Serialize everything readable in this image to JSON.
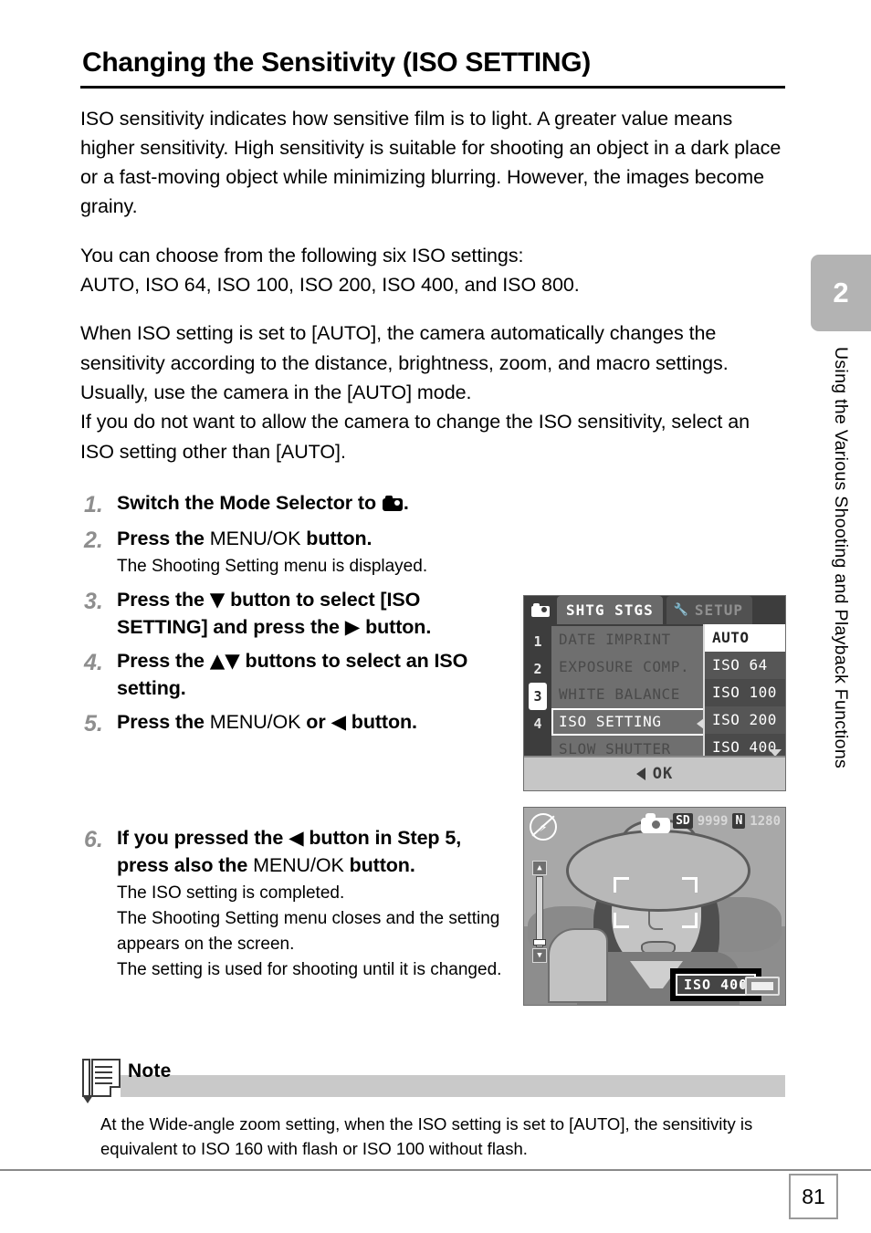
{
  "header": {
    "title": "Changing the Sensitivity (ISO SETTING)"
  },
  "sidebar": {
    "chapter_number": "2",
    "chapter_title": "Using the Various Shooting and Playback Functions"
  },
  "paragraphs": {
    "p1": "ISO sensitivity indicates how sensitive film is to light. A greater value means higher sensitivity. High sensitivity is suitable for shooting an object in a dark place or a fast-moving object while minimizing blurring. However, the images become grainy.",
    "p2_line1": "You can choose from the following six ISO settings:",
    "p2_line2": "AUTO, ISO 64, ISO 100, ISO 200, ISO 400, and ISO 800.",
    "p3_line1": "When ISO setting is set to [AUTO], the camera automatically changes the sensitivity according to the distance, brightness, zoom, and macro settings. Usually, use the camera in the [AUTO] mode.",
    "p3_line2": "If you do not want to allow the camera to change the ISO sensitivity, select an ISO setting other than [AUTO]."
  },
  "steps": [
    {
      "number": "1.",
      "text_before": "Switch the Mode Selector to ",
      "text_after": ".",
      "icon": "camera-mode-icon"
    },
    {
      "number": "2.",
      "text_before": "Press the ",
      "button_label": "MENU/OK",
      "text_after": " button.",
      "sub": [
        "The Shooting Setting menu is displayed."
      ]
    },
    {
      "number": "3.",
      "text_before": "Press the ",
      "glyph1": "▼",
      "text_mid": " button to select [ISO SETTING] and press the ",
      "glyph2": "▶",
      "text_after": " button."
    },
    {
      "number": "4.",
      "text_before": "Press the ",
      "glyph1": "▲▼",
      "text_after": " buttons to select an ISO setting."
    },
    {
      "number": "5.",
      "text_before": "Press the ",
      "button_label": "MENU/OK",
      "text_mid": " or ",
      "glyph1": "◀",
      "text_after": " button."
    },
    {
      "number": "6.",
      "text_before": "If you pressed the ",
      "glyph1": "◀",
      "text_mid": " button in Step 5, press also the ",
      "button_label": "MENU/OK",
      "text_after": " button.",
      "sub": [
        "The ISO setting is completed.",
        "The Shooting Setting menu closes and the setting appears on the screen.",
        "The setting is used for shooting until it is changed."
      ]
    }
  ],
  "lcd_menu": {
    "tab_active": "SHTG STGS",
    "tab_inactive": "SETUP",
    "rail_numbers": [
      "1",
      "2",
      "3",
      "4"
    ],
    "selected_rail": "3",
    "items": [
      "DATE IMPRINT",
      "EXPOSURE COMP.",
      "WHITE BALANCE",
      "ISO SETTING",
      "SLOW SHUTTER LMT"
    ],
    "active_item": "ISO SETTING",
    "values": [
      "AUTO",
      "ISO 64",
      "ISO 100",
      "ISO 200",
      "ISO 400"
    ],
    "selected_value": "AUTO",
    "footer_label": "OK"
  },
  "lcd_preview": {
    "status_card": "SD",
    "status_count": "9999",
    "status_quality": "N",
    "status_size": "1280",
    "iso_badge": "ISO 400",
    "flash_icon": "flash-off-icon",
    "mode_icon": "camera-mode-icon",
    "zoom_top_icon": "tele-icon",
    "zoom_bottom_icon": "wide-icon",
    "battery_icon": "battery-icon"
  },
  "note": {
    "label": "Note",
    "line1": "At the Wide-angle zoom setting, when the ISO setting is set to [AUTO], the sensitivity is",
    "line2": "equivalent to ISO 160 with flash or ISO 100 without flash."
  },
  "footer": {
    "page_number": "81"
  }
}
